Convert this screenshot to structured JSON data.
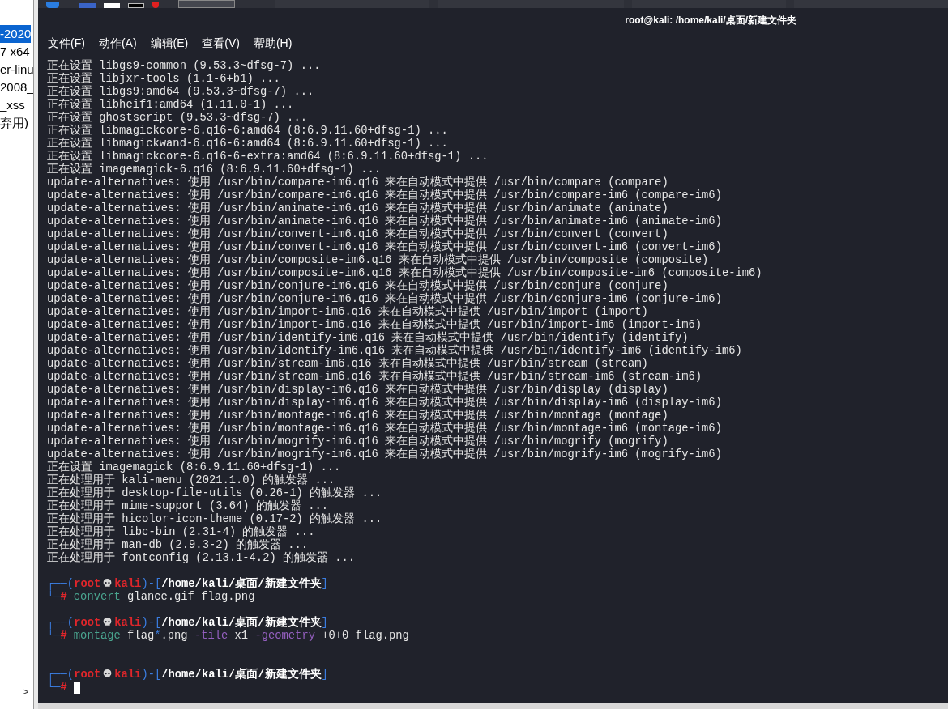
{
  "side_panel": {
    "items": [
      {
        "text": "-2020",
        "selected": true
      },
      {
        "text": "7 x64",
        "selected": false
      },
      {
        "text": "er-linu",
        "selected": false
      },
      {
        "text": "2008_",
        "selected": false
      },
      {
        "text": "_xss",
        "selected": false
      },
      {
        "text": "弃用)",
        "selected": false
      }
    ],
    "scroll_arrow": ">"
  },
  "window": {
    "title": "root@kali: /home/kali/桌面/新建文件夹"
  },
  "menu": [
    "文件(F)",
    "动作(A)",
    "编辑(E)",
    "查看(V)",
    "帮助(H)"
  ],
  "terminal": {
    "output": [
      "正在设置 libgs9-common (9.53.3~dfsg-7) ...",
      "正在设置 libjxr-tools (1.1-6+b1) ...",
      "正在设置 libgs9:amd64 (9.53.3~dfsg-7) ...",
      "正在设置 libheif1:amd64 (1.11.0-1) ...",
      "正在设置 ghostscript (9.53.3~dfsg-7) ...",
      "正在设置 libmagickcore-6.q16-6:amd64 (8:6.9.11.60+dfsg-1) ...",
      "正在设置 libmagickwand-6.q16-6:amd64 (8:6.9.11.60+dfsg-1) ...",
      "正在设置 libmagickcore-6.q16-6-extra:amd64 (8:6.9.11.60+dfsg-1) ...",
      "正在设置 imagemagick-6.q16 (8:6.9.11.60+dfsg-1) ...",
      "update-alternatives: 使用 /usr/bin/compare-im6.q16 来在自动模式中提供 /usr/bin/compare (compare)",
      "update-alternatives: 使用 /usr/bin/compare-im6.q16 来在自动模式中提供 /usr/bin/compare-im6 (compare-im6)",
      "update-alternatives: 使用 /usr/bin/animate-im6.q16 来在自动模式中提供 /usr/bin/animate (animate)",
      "update-alternatives: 使用 /usr/bin/animate-im6.q16 来在自动模式中提供 /usr/bin/animate-im6 (animate-im6)",
      "update-alternatives: 使用 /usr/bin/convert-im6.q16 来在自动模式中提供 /usr/bin/convert (convert)",
      "update-alternatives: 使用 /usr/bin/convert-im6.q16 来在自动模式中提供 /usr/bin/convert-im6 (convert-im6)",
      "update-alternatives: 使用 /usr/bin/composite-im6.q16 来在自动模式中提供 /usr/bin/composite (composite)",
      "update-alternatives: 使用 /usr/bin/composite-im6.q16 来在自动模式中提供 /usr/bin/composite-im6 (composite-im6)",
      "update-alternatives: 使用 /usr/bin/conjure-im6.q16 来在自动模式中提供 /usr/bin/conjure (conjure)",
      "update-alternatives: 使用 /usr/bin/conjure-im6.q16 来在自动模式中提供 /usr/bin/conjure-im6 (conjure-im6)",
      "update-alternatives: 使用 /usr/bin/import-im6.q16 来在自动模式中提供 /usr/bin/import (import)",
      "update-alternatives: 使用 /usr/bin/import-im6.q16 来在自动模式中提供 /usr/bin/import-im6 (import-im6)",
      "update-alternatives: 使用 /usr/bin/identify-im6.q16 来在自动模式中提供 /usr/bin/identify (identify)",
      "update-alternatives: 使用 /usr/bin/identify-im6.q16 来在自动模式中提供 /usr/bin/identify-im6 (identify-im6)",
      "update-alternatives: 使用 /usr/bin/stream-im6.q16 来在自动模式中提供 /usr/bin/stream (stream)",
      "update-alternatives: 使用 /usr/bin/stream-im6.q16 来在自动模式中提供 /usr/bin/stream-im6 (stream-im6)",
      "update-alternatives: 使用 /usr/bin/display-im6.q16 来在自动模式中提供 /usr/bin/display (display)",
      "update-alternatives: 使用 /usr/bin/display-im6.q16 来在自动模式中提供 /usr/bin/display-im6 (display-im6)",
      "update-alternatives: 使用 /usr/bin/montage-im6.q16 来在自动模式中提供 /usr/bin/montage (montage)",
      "update-alternatives: 使用 /usr/bin/montage-im6.q16 来在自动模式中提供 /usr/bin/montage-im6 (montage-im6)",
      "update-alternatives: 使用 /usr/bin/mogrify-im6.q16 来在自动模式中提供 /usr/bin/mogrify (mogrify)",
      "update-alternatives: 使用 /usr/bin/mogrify-im6.q16 来在自动模式中提供 /usr/bin/mogrify-im6 (mogrify-im6)",
      "正在设置 imagemagick (8:6.9.11.60+dfsg-1) ...",
      "正在处理用于 kali-menu (2021.1.0) 的触发器 ...",
      "正在处理用于 desktop-file-utils (0.26-1) 的触发器 ...",
      "正在处理用于 mime-support (3.64) 的触发器 ...",
      "正在处理用于 hicolor-icon-theme (0.17-2) 的触发器 ...",
      "正在处理用于 libc-bin (2.31-4) 的触发器 ...",
      "正在处理用于 man-db (2.9.3-2) 的触发器 ...",
      "正在处理用于 fontconfig (2.13.1-4.2) 的触发器 ..."
    ],
    "prompts": [
      {
        "header": [
          {
            "text": "┌──(",
            "kind": "frame"
          },
          {
            "text": "root",
            "kind": "user"
          },
          {
            "kind": "skull"
          },
          {
            "text": "kali",
            "kind": "host"
          },
          {
            "text": ")-[",
            "kind": "frame"
          },
          {
            "text": "/home/kali/桌面/新建文件夹",
            "kind": "path"
          },
          {
            "text": "]",
            "kind": "frame"
          }
        ],
        "corner": "└─",
        "symbol": "#",
        "command": [
          {
            "text": "convert ",
            "kind": "program"
          },
          {
            "text": "glance.gif",
            "kind": "file"
          },
          {
            "text": " flag.png",
            "kind": "arg"
          }
        ]
      },
      {
        "header": [
          {
            "text": "┌──(",
            "kind": "frame"
          },
          {
            "text": "root",
            "kind": "user"
          },
          {
            "kind": "skull"
          },
          {
            "text": "kali",
            "kind": "host"
          },
          {
            "text": ")-[",
            "kind": "frame"
          },
          {
            "text": "/home/kali/桌面/新建文件夹",
            "kind": "path"
          },
          {
            "text": "]",
            "kind": "frame"
          }
        ],
        "corner": "└─",
        "symbol": "#",
        "command": [
          {
            "text": "montage",
            "kind": "program"
          },
          {
            "text": " flag",
            "kind": "arg"
          },
          {
            "text": "*",
            "kind": "glob"
          },
          {
            "text": ".png ",
            "kind": "arg"
          },
          {
            "text": "-tile",
            "kind": "option"
          },
          {
            "text": " x1 ",
            "kind": "arg"
          },
          {
            "text": "-geometry",
            "kind": "option"
          },
          {
            "text": " +0+0 flag.png",
            "kind": "arg"
          }
        ]
      },
      {
        "header": [
          {
            "text": "┌──(",
            "kind": "frame"
          },
          {
            "text": "root",
            "kind": "user"
          },
          {
            "kind": "skull"
          },
          {
            "text": "kali",
            "kind": "host"
          },
          {
            "text": ")-[",
            "kind": "frame"
          },
          {
            "text": "/home/kali/桌面/新建文件夹",
            "kind": "path"
          },
          {
            "text": "]",
            "kind": "frame"
          }
        ],
        "corner": "└─",
        "symbol": "#",
        "cursor": true
      }
    ]
  }
}
